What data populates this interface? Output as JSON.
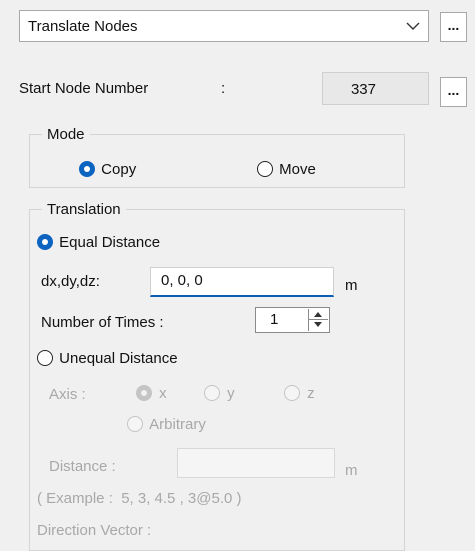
{
  "operation": {
    "selected": "Translate Nodes",
    "more_label": "..."
  },
  "start_node": {
    "label": "Start Node Number",
    "colon": ":",
    "value": "337",
    "more_label": "..."
  },
  "mode": {
    "legend": "Mode",
    "options": [
      {
        "label": "Copy",
        "selected": true
      },
      {
        "label": "Move",
        "selected": false
      }
    ]
  },
  "translation": {
    "legend": "Translation",
    "equal": {
      "label": "Equal Distance",
      "selected": true,
      "dxdydz_label": "dx,dy,dz:",
      "dxdydz_value": "0, 0, 0",
      "unit": "m",
      "times_label": "Number of Times :",
      "times_value": "1"
    },
    "unequal": {
      "label": "Unequal Distance",
      "selected": false,
      "axis_label": "Axis :",
      "axis_options": [
        {
          "label": "x",
          "selected": true
        },
        {
          "label": "y",
          "selected": false
        },
        {
          "label": "z",
          "selected": false
        },
        {
          "label": "Arbitrary",
          "selected": false
        }
      ],
      "distance_label": "Distance :",
      "distance_unit": "m",
      "example": "( Example :  5, 3, 4.5 , 3@5.0 )",
      "direction_label": "Direction Vector :"
    }
  }
}
